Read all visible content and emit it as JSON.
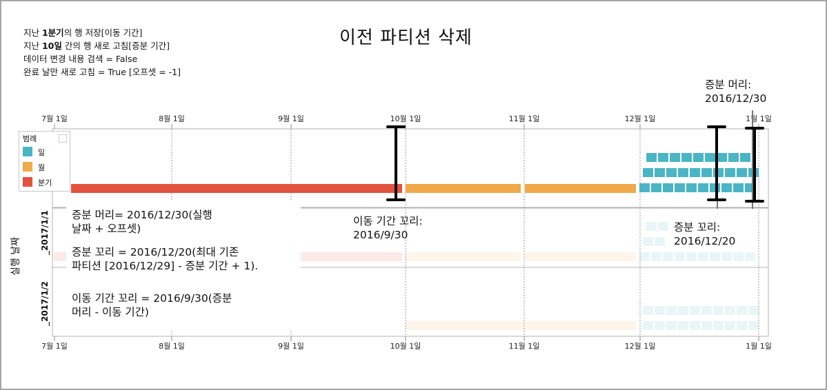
{
  "title": "이전 파티션 삭제",
  "notes": {
    "line1_bold": "1분기",
    "line1_pre": "지난 ",
    "line1_post": "의 행 저장[이동 기간]",
    "line2_pre": "지난 ",
    "line2_bold": "10일",
    "line2_post": " 간의 행 새로 고침[증분 기간]",
    "line3": "데이터 변경 내용 검색 = False",
    "line4": "완료 날만 새로 고침 = True [오프셋 = -1]"
  },
  "axis": {
    "top_ticks": [
      "7월 1일",
      "8월 1일",
      "9월 1일",
      "10월 1일",
      "11월 1일",
      "12월 1일",
      "1월 1일"
    ],
    "bottom_ticks": [
      "7월 1일",
      "8월 1일",
      "9월 1일",
      "10월 1일",
      "11월 1일",
      "12월 1일",
      "1월 1일"
    ]
  },
  "legend": {
    "title": "범례",
    "items": [
      {
        "label": "일",
        "color": "#4ab5c4"
      },
      {
        "label": "월",
        "color": "#f1a94a"
      },
      {
        "label": "분기",
        "color": "#e2533f"
      }
    ]
  },
  "y_axis_label": "실행 날짜",
  "rows": [
    "_2017/1/1",
    "_2017/1/2"
  ],
  "callouts": {
    "incremental_head": [
      "증분 머리:",
      "2016/12/30"
    ],
    "rolling_tail": [
      "이동 기간 꼬리:",
      "2016/9/30"
    ],
    "incremental_tail": [
      "증분 꼬리:",
      "2016/12/20"
    ]
  },
  "explanations": [
    [
      "증분 머리= 2016/12/30(실행",
      "날짜 + 오프셋)"
    ],
    [
      "증분 꼬리 = 2016/12/20(최대 기존",
      "파티션 [2016/12/29] - 증분 기간 + 1)."
    ],
    [
      "이동 기간 꼬리 = 2016/9/30(증분",
      "머리 - 이동 기간)"
    ]
  ],
  "colors": {
    "day": "#4ab5c4",
    "month": "#f1a94a",
    "quarter": "#e2533f"
  }
}
